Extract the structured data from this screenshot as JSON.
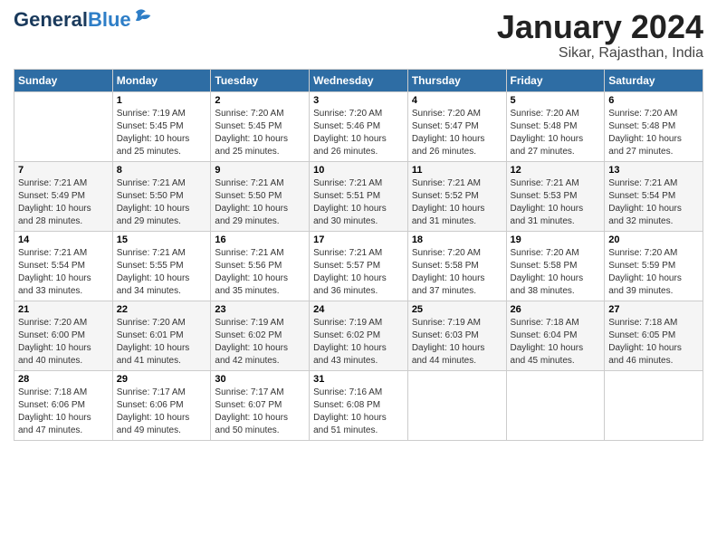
{
  "header": {
    "logo_general": "General",
    "logo_blue": "Blue",
    "month_title": "January 2024",
    "location": "Sikar, Rajasthan, India"
  },
  "days_of_week": [
    "Sunday",
    "Monday",
    "Tuesday",
    "Wednesday",
    "Thursday",
    "Friday",
    "Saturday"
  ],
  "weeks": [
    [
      {
        "day": "",
        "info": ""
      },
      {
        "day": "1",
        "info": "Sunrise: 7:19 AM\nSunset: 5:45 PM\nDaylight: 10 hours\nand 25 minutes."
      },
      {
        "day": "2",
        "info": "Sunrise: 7:20 AM\nSunset: 5:45 PM\nDaylight: 10 hours\nand 25 minutes."
      },
      {
        "day": "3",
        "info": "Sunrise: 7:20 AM\nSunset: 5:46 PM\nDaylight: 10 hours\nand 26 minutes."
      },
      {
        "day": "4",
        "info": "Sunrise: 7:20 AM\nSunset: 5:47 PM\nDaylight: 10 hours\nand 26 minutes."
      },
      {
        "day": "5",
        "info": "Sunrise: 7:20 AM\nSunset: 5:48 PM\nDaylight: 10 hours\nand 27 minutes."
      },
      {
        "day": "6",
        "info": "Sunrise: 7:20 AM\nSunset: 5:48 PM\nDaylight: 10 hours\nand 27 minutes."
      }
    ],
    [
      {
        "day": "7",
        "info": "Sunrise: 7:21 AM\nSunset: 5:49 PM\nDaylight: 10 hours\nand 28 minutes."
      },
      {
        "day": "8",
        "info": "Sunrise: 7:21 AM\nSunset: 5:50 PM\nDaylight: 10 hours\nand 29 minutes."
      },
      {
        "day": "9",
        "info": "Sunrise: 7:21 AM\nSunset: 5:50 PM\nDaylight: 10 hours\nand 29 minutes."
      },
      {
        "day": "10",
        "info": "Sunrise: 7:21 AM\nSunset: 5:51 PM\nDaylight: 10 hours\nand 30 minutes."
      },
      {
        "day": "11",
        "info": "Sunrise: 7:21 AM\nSunset: 5:52 PM\nDaylight: 10 hours\nand 31 minutes."
      },
      {
        "day": "12",
        "info": "Sunrise: 7:21 AM\nSunset: 5:53 PM\nDaylight: 10 hours\nand 31 minutes."
      },
      {
        "day": "13",
        "info": "Sunrise: 7:21 AM\nSunset: 5:54 PM\nDaylight: 10 hours\nand 32 minutes."
      }
    ],
    [
      {
        "day": "14",
        "info": "Sunrise: 7:21 AM\nSunset: 5:54 PM\nDaylight: 10 hours\nand 33 minutes."
      },
      {
        "day": "15",
        "info": "Sunrise: 7:21 AM\nSunset: 5:55 PM\nDaylight: 10 hours\nand 34 minutes."
      },
      {
        "day": "16",
        "info": "Sunrise: 7:21 AM\nSunset: 5:56 PM\nDaylight: 10 hours\nand 35 minutes."
      },
      {
        "day": "17",
        "info": "Sunrise: 7:21 AM\nSunset: 5:57 PM\nDaylight: 10 hours\nand 36 minutes."
      },
      {
        "day": "18",
        "info": "Sunrise: 7:20 AM\nSunset: 5:58 PM\nDaylight: 10 hours\nand 37 minutes."
      },
      {
        "day": "19",
        "info": "Sunrise: 7:20 AM\nSunset: 5:58 PM\nDaylight: 10 hours\nand 38 minutes."
      },
      {
        "day": "20",
        "info": "Sunrise: 7:20 AM\nSunset: 5:59 PM\nDaylight: 10 hours\nand 39 minutes."
      }
    ],
    [
      {
        "day": "21",
        "info": "Sunrise: 7:20 AM\nSunset: 6:00 PM\nDaylight: 10 hours\nand 40 minutes."
      },
      {
        "day": "22",
        "info": "Sunrise: 7:20 AM\nSunset: 6:01 PM\nDaylight: 10 hours\nand 41 minutes."
      },
      {
        "day": "23",
        "info": "Sunrise: 7:19 AM\nSunset: 6:02 PM\nDaylight: 10 hours\nand 42 minutes."
      },
      {
        "day": "24",
        "info": "Sunrise: 7:19 AM\nSunset: 6:02 PM\nDaylight: 10 hours\nand 43 minutes."
      },
      {
        "day": "25",
        "info": "Sunrise: 7:19 AM\nSunset: 6:03 PM\nDaylight: 10 hours\nand 44 minutes."
      },
      {
        "day": "26",
        "info": "Sunrise: 7:18 AM\nSunset: 6:04 PM\nDaylight: 10 hours\nand 45 minutes."
      },
      {
        "day": "27",
        "info": "Sunrise: 7:18 AM\nSunset: 6:05 PM\nDaylight: 10 hours\nand 46 minutes."
      }
    ],
    [
      {
        "day": "28",
        "info": "Sunrise: 7:18 AM\nSunset: 6:06 PM\nDaylight: 10 hours\nand 47 minutes."
      },
      {
        "day": "29",
        "info": "Sunrise: 7:17 AM\nSunset: 6:06 PM\nDaylight: 10 hours\nand 49 minutes."
      },
      {
        "day": "30",
        "info": "Sunrise: 7:17 AM\nSunset: 6:07 PM\nDaylight: 10 hours\nand 50 minutes."
      },
      {
        "day": "31",
        "info": "Sunrise: 7:16 AM\nSunset: 6:08 PM\nDaylight: 10 hours\nand 51 minutes."
      },
      {
        "day": "",
        "info": ""
      },
      {
        "day": "",
        "info": ""
      },
      {
        "day": "",
        "info": ""
      }
    ]
  ]
}
